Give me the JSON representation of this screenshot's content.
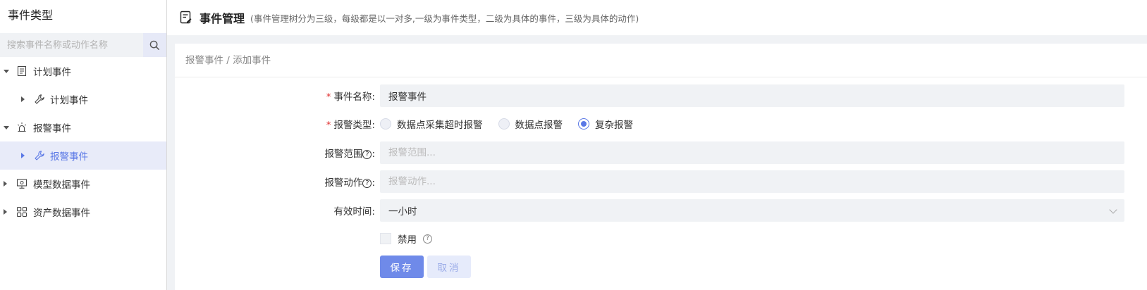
{
  "sidebar": {
    "title": "事件类型",
    "search_placeholder": "搜索事件名称或动作名称",
    "tree": [
      {
        "label": "计划事件",
        "icon": "document-list-icon"
      },
      {
        "label": "计划事件",
        "icon": "wrench-icon"
      },
      {
        "label": "报警事件",
        "icon": "alarm-light-icon"
      },
      {
        "label": "报警事件",
        "icon": "wrench-icon",
        "selected": true
      },
      {
        "label": "模型数据事件",
        "icon": "monitor-icon"
      },
      {
        "label": "资产数据事件",
        "icon": "grid-apps-icon"
      }
    ]
  },
  "header": {
    "title": "事件管理",
    "description": "(事件管理树分为三级，每级都是以一对多,一级为事件类型，二级为具体的事件，三级为具体的动作)"
  },
  "breadcrumb": "报警事件 / 添加事件",
  "form": {
    "event_name_label": "事件名称:",
    "event_name_value": "报警事件",
    "alarm_type_label": "报警类型:",
    "alarm_type_options": [
      "数据点采集超时报警",
      "数据点报警",
      "复杂报警"
    ],
    "alarm_type_selected": "复杂报警",
    "alarm_range_label": "报警范围",
    "alarm_range_placeholder": "报警范围...",
    "alarm_action_label": "报警动作",
    "alarm_action_placeholder": "报警动作...",
    "valid_time_label": "有效时间:",
    "valid_time_value": "一小时",
    "disable_label": "禁用",
    "help_glyph": "?",
    "save_label": "保存",
    "cancel_label": "取消"
  },
  "colors": {
    "accent": "#5a78e6",
    "required": "#e03030"
  }
}
